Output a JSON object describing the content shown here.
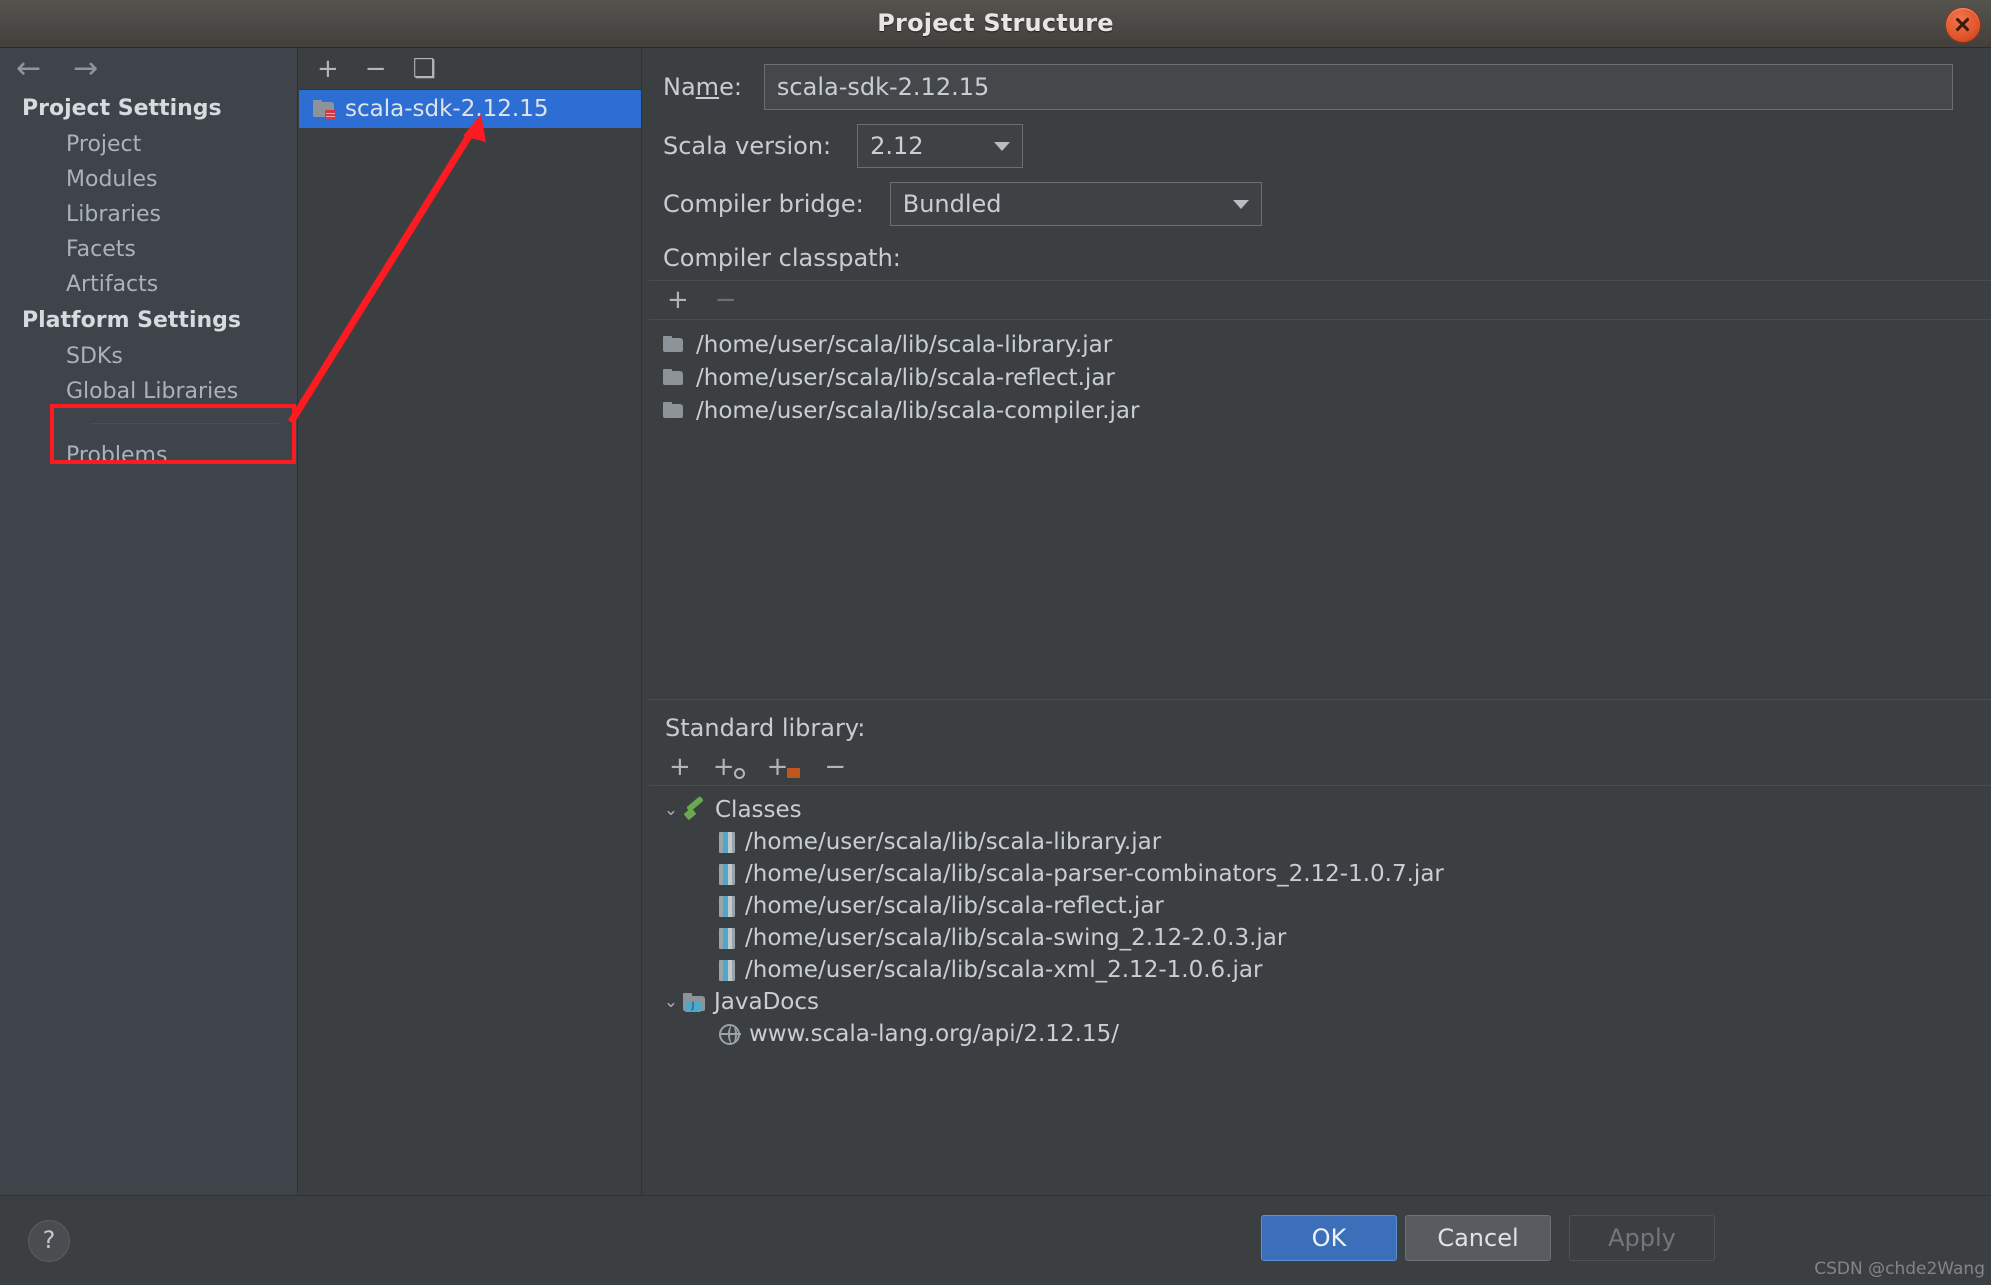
{
  "window": {
    "title": "Project Structure",
    "close_icon": "close-icon"
  },
  "sidebar": {
    "back_icon": "←",
    "forward_icon": "→",
    "groups": [
      {
        "title": "Project Settings",
        "items": [
          "Project",
          "Modules",
          "Libraries",
          "Facets",
          "Artifacts"
        ]
      },
      {
        "title": "Platform Settings",
        "items": [
          "SDKs",
          "Global Libraries"
        ]
      }
    ],
    "footer_items": [
      "Problems"
    ]
  },
  "list_panel": {
    "toolbar": {
      "add_label": "+",
      "remove_label": "−",
      "copy_label": "❏"
    },
    "items": [
      {
        "label": "scala-sdk-2.12.15",
        "selected": true,
        "icon": "sdk-folder-icon"
      }
    ]
  },
  "detail": {
    "name_label_pre": "Na",
    "name_label_mnemonic": "m",
    "name_label_post": "e:",
    "name_value": "scala-sdk-2.12.15",
    "scala_version_label": "Scala version:",
    "scala_version_value": "2.12",
    "compiler_bridge_label": "Compiler bridge:",
    "compiler_bridge_value": "Bundled",
    "compiler_classpath_label": "Compiler classpath:",
    "classpath_toolbar": {
      "add_label": "+",
      "remove_label": "−"
    },
    "classpath": [
      "/home/user/scala/lib/scala-library.jar",
      "/home/user/scala/lib/scala-reflect.jar",
      "/home/user/scala/lib/scala-compiler.jar"
    ],
    "standard_library_label": "Standard library:",
    "std_toolbar": {
      "add_label": "+",
      "add_url_label": "+",
      "add_dir_label": "+",
      "remove_label": "−"
    },
    "tree": [
      {
        "label": "Classes",
        "icon": "classes-icon",
        "chevron": "⌄",
        "children": [
          "/home/user/scala/lib/scala-library.jar",
          "/home/user/scala/lib/scala-parser-combinators_2.12-1.0.7.jar",
          "/home/user/scala/lib/scala-reflect.jar",
          "/home/user/scala/lib/scala-swing_2.12-2.0.3.jar",
          "/home/user/scala/lib/scala-xml_2.12-1.0.6.jar"
        ],
        "child_icon": "jar-icon"
      },
      {
        "label": "JavaDocs",
        "icon": "javadoc-folder-icon",
        "chevron": "⌄",
        "children": [
          "www.scala-lang.org/api/2.12.15/"
        ],
        "child_icon": "globe-icon"
      }
    ]
  },
  "footer": {
    "help_label": "?",
    "ok_label": "OK",
    "cancel_label": "Cancel",
    "apply_label": "Apply",
    "watermark": "CSDN @chde2Wang"
  },
  "annotation": {
    "color": "#fd1b21",
    "highlight_target": "Global Libraries",
    "arrow_target": "scala-sdk-2.12.15"
  }
}
